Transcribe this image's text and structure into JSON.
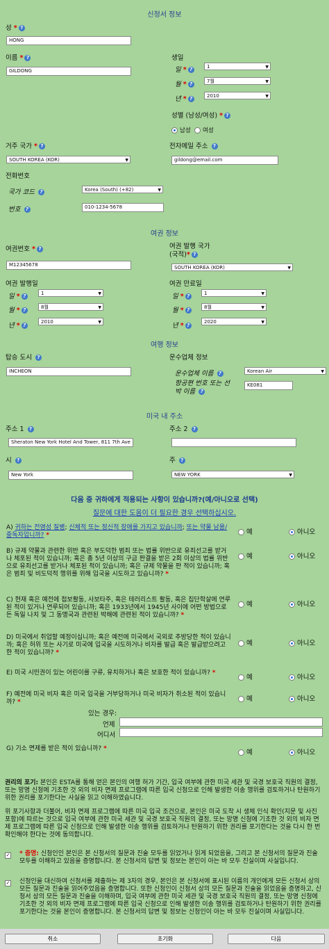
{
  "applicant": {
    "header": "신청서 정보",
    "surname_label": "성",
    "surname_value": "HONG",
    "given_label": "이름",
    "given_value": "GILDONG",
    "dob_label": "생일",
    "day_label": "일",
    "month_label": "월",
    "year_label": "년",
    "dob_day": "1",
    "dob_month": "7월",
    "dob_year": "2010",
    "gender_label": "성별 (남성/여성)",
    "male_label": "남성",
    "female_label": "여성",
    "residence_label": "거주 국가",
    "residence_value": "SOUTH KOREA (KOR)",
    "email_label": "전자메일 주소",
    "email_value": "gildong@email.com",
    "phone_label": "전화번호",
    "country_code_label": "국가 코드",
    "country_code_value": "Korea (South) (+82)",
    "number_label": "번호",
    "number_value": "010-1234-5678"
  },
  "passport": {
    "header": "여권 정보",
    "number_label": "여권번호",
    "number_value": "M12345678",
    "issuing_label_1": "여권 발행 국가",
    "issuing_label_2": "(국적)",
    "issuing_value": "SOUTH KOREA (KOR)",
    "issue_label": "여권 발행일",
    "expiry_label": "여권 만료일",
    "issue_day": "1",
    "issue_month": "8월",
    "issue_year": "2010",
    "expiry_day": "1",
    "expiry_month": "8월",
    "expiry_year": "2020"
  },
  "travel": {
    "header": "여행 정보",
    "city_label": "탑승 도시",
    "city_value": "INCHEON",
    "carrier_label": "운수업체 정보",
    "carrier_name_label": "운수업체 이름",
    "carrier_name_value": "Korean Air",
    "flight_label_1": "항공편 번호 또는 선",
    "flight_label_2": "박 이름",
    "flight_value": "KE081"
  },
  "us_address": {
    "header": "미국 내 주소",
    "addr1_label": "주소 1",
    "addr1_value": "Sheraton New York Hotel And Tower, 811 7th Ave",
    "addr2_label": "주소 2",
    "addr2_value": "",
    "city_label": "시",
    "city_value": "New York",
    "state_label": "주",
    "state_value": "NEW YORK"
  },
  "eligibility": {
    "title": "다음 중 귀하에게 적용되는 사항이 있습니까?(예/아니오로 선택)",
    "help_link": "질문에 대한 도움이 더 필요한 경우 선택하십시오.",
    "yes": "예",
    "no": "아니오",
    "qa_prefix": "A) ",
    "qa_link1": "귀하는 전염성 질병",
    "qa_sep1": "; ",
    "qa_link2": "신체적 또는 정신적 장애를 가지고 있습니까",
    "qa_sep2": "; ",
    "qa_link3": "또는 약물 남용/중독자입니까?",
    "qb": "B) 규제 약물과 관련한 위반 혹은 부도덕한 범죄 또는 법률 위반으로 유죄선고를 받거나 체포된 적이 있습니까; 혹은 총 5년 이상의 구금 판결을 받은 2회 이상의 법률 위반으로 유죄선고를 받거나 체포된 적이 있습니까; 혹은 규제 약물을 판 적이 있습니까; 혹은 범죄 및 비도덕적 행위를 위해 입국을 시도하고 있습니까?",
    "qc": "C) 현재 혹은 예전에 첩보활동, 사보타주, 혹은 테러리스트 활동, 혹은 집단학살에 연루된 적이 있거나 연루되어 있습니까; 혹은 1933년에서 1945년 사이에 어떤 방법으로든 독일 나치 및 그 동맹국과 관련된 박해에 관련된 적이 있습니까?",
    "qd": "D) 미국에서 취업할 예정이십니까; 혹은 예전에 미국에서 국외로 추방당한 적이 있습니까; 혹은 허위 또는 사기로 미국에 입국을 시도하거나 비자를 발급 혹은 발급받으려고 한 적이 있습니까?",
    "qe": "E) 미국 시민권이 있는 어린이를 구류, 유치하거나 혹은 보호한 적이 있습니까?",
    "qf": "F) 예전에 미국 비자 혹은 미국 입국을 거부당하거나 미국 비자가 취소된 적이 있습니까?",
    "qf_if_yes": "있는 경우:",
    "qf_when": "언제",
    "qf_where": "어디서",
    "qg": "G) 기소 면제를 받은 적이 있습니까?"
  },
  "waiver": {
    "title": "권리의 포기:",
    "text1": " 본인은 ESTA를 통해 얻은 본인의 여행 허가 기간, 입국 여부에 관한 미국 세관 및 국경 보호국 직원의 결정, 또는 망명 신청에 기초한 것 외의 비자 면제 프로그램에 따른 입국 신청으로 인해 발생한 이송 행위를 검토하거나 탄원하기 위한 권리를 포기한다는 사실을 읽고 이해하였습니다.",
    "text2": "위 포기사항과 더불어, 비자 면제 프로그램에 따른 미국 입국 조건으로, 본인은 미국 도착 시 생체 인식 확인(지문 및 사진 포함)에 따르는 것으로 입국 여부에 관한 미국 세관 및 국경 보호국 직원의 결정, 또는 망명 신청에 기초한 것 외의 비자 면제 프로그램에 따른 입국 신청으로 인해 발생한 이송 행위를 검토하거나 탄원하기 위한 권리를 포기한다는 것을 다시 한 번 확인해야 한다는 것에 동의합니다.",
    "cert_label": "* 증명:",
    "cert_text": " 신청인인 본인은 본 신청서의 질문과 진술 모두를 읽었거나 읽게 되었음을, 그리고 본 신청서의 질문과 진술 모두를 이해하고 있음을 증명합니다. 본 신청서의 답변 및 정보는 본인이 아는 바 모두 진실이며 사실입니다.",
    "proxy_text": "신청인을 대신하여 신청서를 제출하는 제 3자의 경우, 본인은 본 신청서에 표시된 이름의 개인에게 모든 신청서 상의 모든 질문과 진술을 읽어주었음을 증명합니다. 또한 신청인이 신청서 상의 모든 질문과 진술을 읽었음을 증명하고, 신청서 상의 모든 질문과 진술을 이해하며, 입국 여부에 관한 미국 세관 및 국경 보호국 직원의 결정, 또는 망명 신청에 기초한 것 외의 비자 면제 프로그램에 따른 입국 신청으로 인해 발생한 이송 행위를 검토하거나 탄원하기 위한 권리를 포기한다는 것을 본인이 증명합니다. 본 신청서의 답변 및 정보는 신청인이 아는 바 모두 진실이며 사실입니다."
  },
  "buttons": {
    "cancel": "취소",
    "reset": "초기화",
    "next": "다음"
  }
}
